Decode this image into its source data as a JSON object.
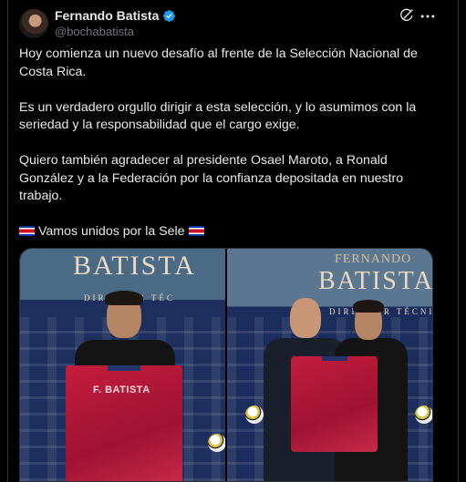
{
  "author": {
    "display_name": "Fernando Batista",
    "handle": "@bochabatista"
  },
  "tweet": {
    "paragraphs": [
      "Hoy comienza un nuevo desafío al frente de la Selección Nacional de Costa Rica.",
      "Es un verdadero orgullo dirigir a esta selección, y lo asumimos con la seriedad y la responsabilidad que el cargo exige.",
      "Quiero también agradecer al presidente Osael Maroto, a Ronald González y a la Federación por la confianza depositada en nuestro trabajo."
    ],
    "closing_line": "Vamos unidos por la Sele"
  },
  "media": {
    "photo1": {
      "banner_name": "BATISTA",
      "banner_subtitle": "DIRECTOR TÉC",
      "jersey_text": "F. BATISTA"
    },
    "photo2": {
      "banner_first": "FERNANDO",
      "banner_name": "BATISTA",
      "banner_subtitle": "DIRECTOR TÉCNICO"
    }
  },
  "colors": {
    "background": "#000000",
    "text": "#e7e9ea",
    "muted": "#71767b",
    "verified": "#1d9bf0",
    "border": "#2f3336"
  },
  "icons": [
    "verified-badge-icon",
    "grok-icon",
    "more-options-icon",
    "costa-rica-flag-icon"
  ]
}
